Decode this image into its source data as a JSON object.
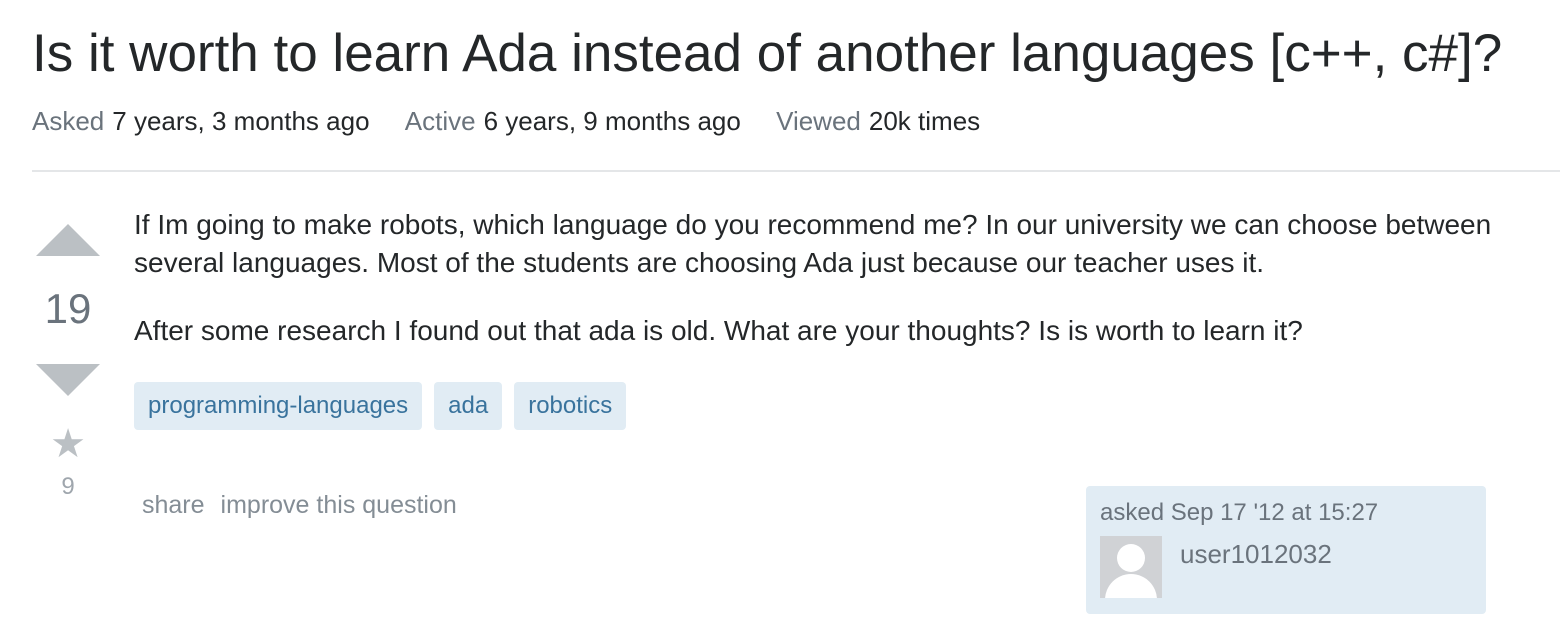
{
  "question": {
    "title": "Is it worth to learn Ada instead of another languages [c++, c#]?",
    "meta": {
      "asked_label": "Asked",
      "asked_value": "7 years, 3 months ago",
      "active_label": "Active",
      "active_value": "6 years, 9 months ago",
      "viewed_label": "Viewed",
      "viewed_value": "20k times"
    },
    "votes": "19",
    "favorites": "9",
    "star_icon": "star-icon",
    "body": [
      "If Im going to make robots, which language do you recommend me? In our university we can choose between several languages. Most of the students are choosing Ada just because our teacher uses it.",
      "After some research I found out that ada is old. What are your thoughts? Is is worth to learn it?"
    ],
    "tags": [
      "programming-languages",
      "ada",
      "robotics"
    ],
    "menu": {
      "share": "share",
      "improve": "improve this question"
    },
    "owner": {
      "asked_time": "asked Sep 17 '12 at 15:27",
      "user_name": "user1012032"
    }
  },
  "colors": {
    "tag_bg": "#e1ecf4",
    "tag_text": "#39739d",
    "muted": "#6a737c",
    "vote_arrow": "#bbc0c4"
  }
}
